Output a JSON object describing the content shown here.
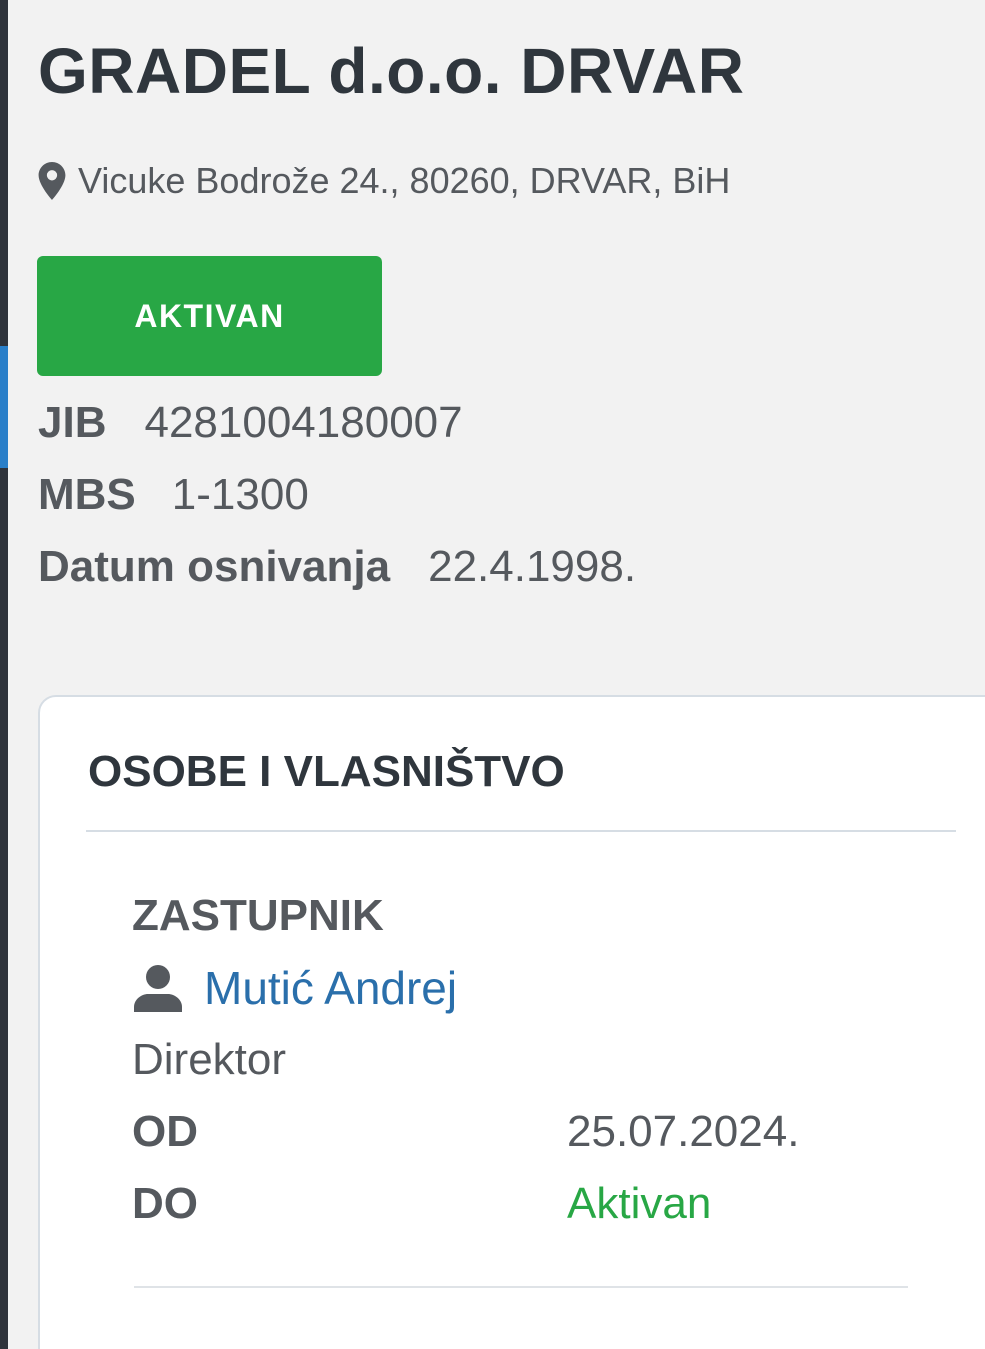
{
  "company": {
    "title": "GRADEL d.o.o. DRVAR",
    "address": "Vicuke Bodrože 24., 80260, DRVAR, BiH",
    "status_label": "AKTIVAN",
    "status_color": "#28a745",
    "icons": {
      "address": "map-marker-icon"
    }
  },
  "info": {
    "jib": {
      "label": "JIB",
      "value": "4281004180007"
    },
    "mbs": {
      "label": "MBS",
      "value": "1-1300"
    },
    "datum": {
      "label": "Datum osnivanja",
      "value": "22.4.1998."
    }
  },
  "section": {
    "title": "OSOBE I VLASNIŠTVO",
    "role_heading": "ZASTUPNIK",
    "person": {
      "name": "Mutić Andrej",
      "icon": "user-icon",
      "link_color": "#2a6fab",
      "position": "Direktor",
      "from_label": "OD",
      "from_value": "25.07.2024.",
      "to_label": "DO",
      "to_value": "Aktivan",
      "to_color": "#28a745"
    }
  },
  "theme": {
    "accent": "#2a7fc9",
    "rail": "#2f333b",
    "background": "#f2f2f2"
  }
}
